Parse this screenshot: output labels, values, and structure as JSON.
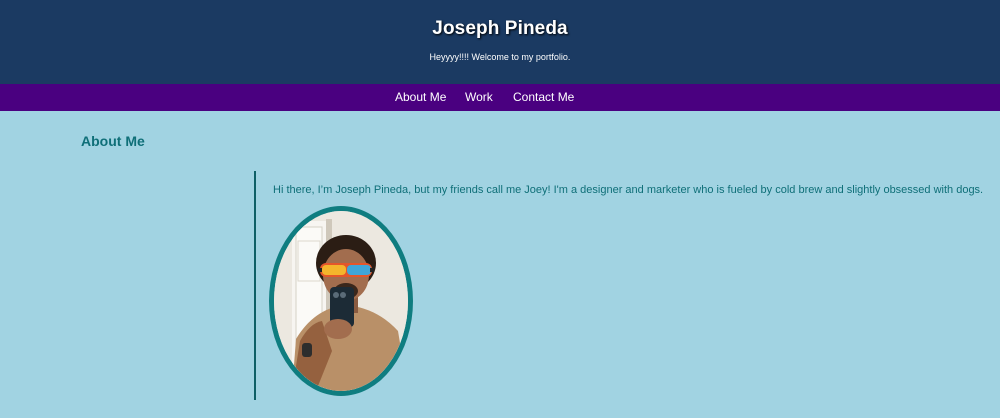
{
  "header": {
    "title": "Joseph Pineda",
    "tagline": "Heyyyy!!!! Welcome to my portfolio."
  },
  "nav": {
    "items": [
      {
        "label": "About Me"
      },
      {
        "label": "Work"
      },
      {
        "label": "Contact Me"
      }
    ]
  },
  "about": {
    "heading": "About Me",
    "intro": "Hi there, I’m Joseph Pineda, but my friends call me Joey! I'm a designer and marketer who is fueled by cold brew and slightly obsessed with dogs.",
    "photo_icon": "profile-photo"
  },
  "colors": {
    "header_bg": "#1b3a62",
    "nav_bg": "#4a0080",
    "page_bg": "#a1d3e2",
    "accent_teal": "#0f6f78"
  }
}
